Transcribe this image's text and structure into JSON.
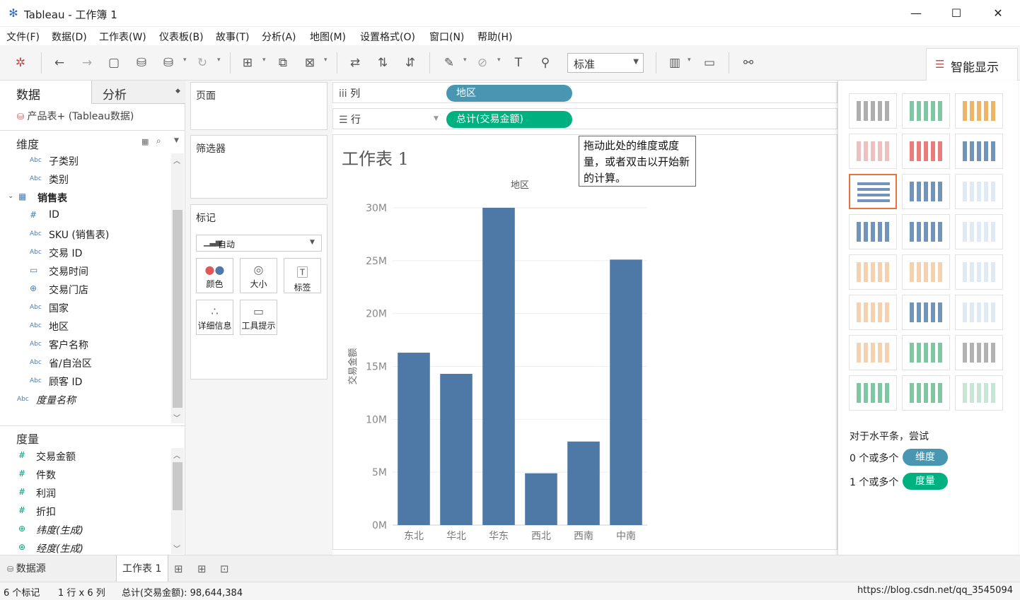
{
  "window": {
    "title": "Tableau - 工作簿 1",
    "minimize": "—",
    "maximize": "☐",
    "close": "✕"
  },
  "menu": [
    "文件(F)",
    "数据(D)",
    "工作表(W)",
    "仪表板(B)",
    "故事(T)",
    "分析(A)",
    "地图(M)",
    "设置格式(O)",
    "窗口(N)",
    "帮助(H)"
  ],
  "toolbar": {
    "fit_value": "标准",
    "smart_show_label": "智能显示"
  },
  "left": {
    "tab_data": "数据",
    "tab_analysis": "分析",
    "datasource": "产品表+ (Tableau数据)",
    "dimensions_header": "维度",
    "dimensions": [
      {
        "type": "Abc",
        "name": "子类别"
      },
      {
        "type": "Abc",
        "name": "类别"
      },
      {
        "type": "tbl",
        "name": "销售表"
      },
      {
        "type": "#",
        "name": "ID"
      },
      {
        "type": "Abc",
        "name": "SKU (销售表)"
      },
      {
        "type": "Abc",
        "name": "交易 ID"
      },
      {
        "type": "date",
        "name": "交易时间"
      },
      {
        "type": "geo",
        "name": "交易门店"
      },
      {
        "type": "Abc",
        "name": "国家"
      },
      {
        "type": "Abc",
        "name": "地区"
      },
      {
        "type": "Abc",
        "name": "客户名称"
      },
      {
        "type": "Abc",
        "name": "省/自治区"
      },
      {
        "type": "Abc",
        "name": "顾客 ID"
      },
      {
        "type": "Abc",
        "name": "度量名称"
      }
    ],
    "measures_header": "度量",
    "measures": [
      {
        "type": "#",
        "name": "交易金额"
      },
      {
        "type": "#",
        "name": "件数"
      },
      {
        "type": "#",
        "name": "利润"
      },
      {
        "type": "#",
        "name": "折扣"
      },
      {
        "type": "geo",
        "name": "纬度(生成)"
      },
      {
        "type": "geo",
        "name": "经度(生成)"
      }
    ]
  },
  "cards": {
    "pages": "页面",
    "filters": "筛选器",
    "marks": "标记",
    "mark_type": "自动",
    "mark_buttons": [
      "颜色",
      "大小",
      "标签",
      "详细信息",
      "工具提示"
    ]
  },
  "shelves": {
    "columns_label": "列",
    "columns_pill": "地区",
    "rows_label": "行",
    "rows_pill": "总计(交易金额)"
  },
  "viz": {
    "sheet_title": "工作表 1",
    "tooltip": "拖动此处的维度或度量，或者双击以开始新的计算。"
  },
  "chart_data": {
    "type": "bar",
    "title": "地区",
    "xlabel": "",
    "ylabel": "交易金额",
    "categories": [
      "东北",
      "华北",
      "华东",
      "西北",
      "西南",
      "中南"
    ],
    "values": [
      16.3,
      14.3,
      30.0,
      4.9,
      7.9,
      25.1
    ],
    "ylim": [
      0,
      30
    ],
    "yticks": [
      "0M",
      "5M",
      "10M",
      "15M",
      "20M",
      "25M",
      "30M"
    ],
    "bar_color": "#4e79a7",
    "grid": true
  },
  "smart": {
    "hint": "对于水平条，尝试",
    "dim_text": "0 个或多个",
    "dim_pill": "维度",
    "mea_text": "1 个或多个",
    "mea_pill": "度量"
  },
  "bottom": {
    "datasource_tab": "数据源",
    "sheet_tab": "工作表 1"
  },
  "status": {
    "marks": "6 个标记",
    "grid": "1 行 x 6 列",
    "sum": "总计(交易金额): 98,644,384",
    "watermark": "https://blog.csdn.net/qq_3545094"
  },
  "colors": {
    "dim_pill": "#4996b2",
    "mea_pill": "#00b180",
    "accent": "#e8733f"
  }
}
